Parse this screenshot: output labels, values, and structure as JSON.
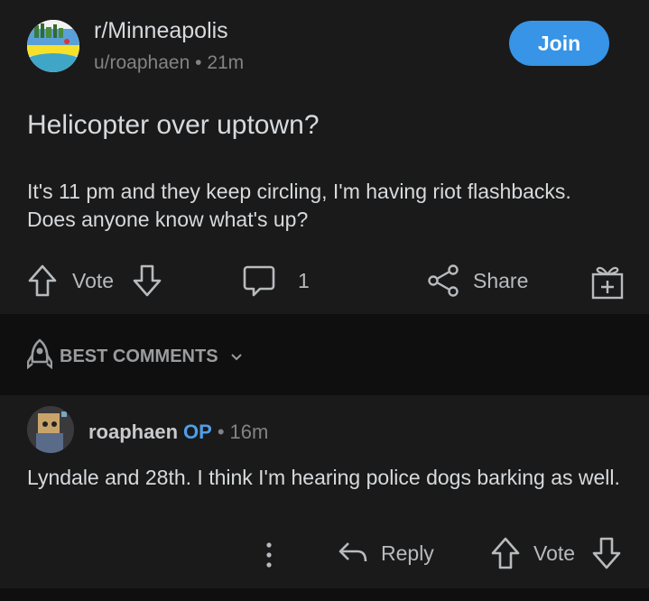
{
  "post": {
    "subreddit": "r/Minneapolis",
    "author": "u/roaphaen",
    "separator": "•",
    "time": "21m",
    "join_label": "Join",
    "title": "Helicopter over uptown?",
    "body": "It's 11 pm and they keep circling, I'm having riot flashbacks. Does anyone know what's up?",
    "vote_label": "Vote",
    "comment_count": "1",
    "share_label": "Share"
  },
  "comments_section": {
    "sort_label": "BEST COMMENTS"
  },
  "comment": {
    "username": "roaphaen",
    "op_badge": "OP",
    "separator": "•",
    "time": "16m",
    "text": "Lyndale and 28th. I think I'm hearing police dogs barking as well.",
    "reply_label": "Reply",
    "vote_label": "Vote"
  },
  "colors": {
    "background": "#1a1a1b",
    "accent": "#3794e6",
    "op_badge": "#4f9ee8"
  }
}
